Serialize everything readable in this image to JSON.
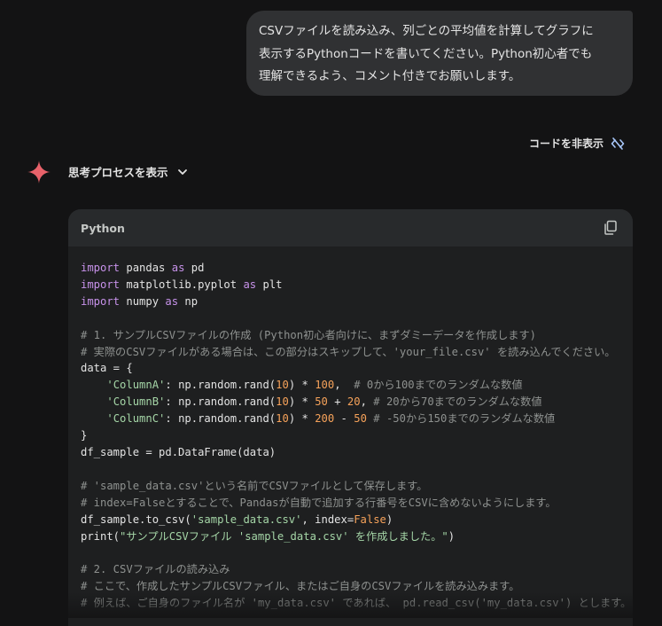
{
  "user_message": {
    "lines": [
      "CSVファイルを読み込み、列ごとの平均値を計算してグラフに",
      "表示するPythonコードを書いてください。Python初心者でも",
      "理解できるよう、コメント付きでお願いします。"
    ]
  },
  "toolbar": {
    "hide_code_label": "コードを非表示",
    "hide_code_icon": "code-off-icon"
  },
  "response": {
    "thinking_label": "思考プロセスを表示",
    "assistant_icon": "sparkle-icon",
    "accent": "#e8626a"
  },
  "code_block": {
    "language": "Python",
    "copy_icon": "copy-icon",
    "lines": [
      [
        [
          "kw",
          "import"
        ],
        [
          "t",
          " pandas "
        ],
        [
          "kw",
          "as"
        ],
        [
          "t",
          " pd"
        ]
      ],
      [
        [
          "kw",
          "import"
        ],
        [
          "t",
          " matplotlib.pyplot "
        ],
        [
          "kw",
          "as"
        ],
        [
          "t",
          " plt"
        ]
      ],
      [
        [
          "kw",
          "import"
        ],
        [
          "t",
          " numpy "
        ],
        [
          "kw",
          "as"
        ],
        [
          "t",
          " np"
        ]
      ],
      [],
      [
        [
          "cm",
          "# 1. サンプルCSVファイルの作成 (Python初心者向けに、まずダミーデータを作成します)"
        ]
      ],
      [
        [
          "cm",
          "# 実際のCSVファイルがある場合は、この部分はスキップして、'your_file.csv' を読み込んでください。"
        ]
      ],
      [
        [
          "t",
          "data = {"
        ]
      ],
      [
        [
          "t",
          "    "
        ],
        [
          "str",
          "'ColumnA'"
        ],
        [
          "t",
          ": np.random.rand("
        ],
        [
          "num",
          "10"
        ],
        [
          "t",
          ") * "
        ],
        [
          "num",
          "100"
        ],
        [
          "t",
          ",  "
        ],
        [
          "cm",
          "# 0から100までのランダムな数値"
        ]
      ],
      [
        [
          "t",
          "    "
        ],
        [
          "str",
          "'ColumnB'"
        ],
        [
          "t",
          ": np.random.rand("
        ],
        [
          "num",
          "10"
        ],
        [
          "t",
          ") * "
        ],
        [
          "num",
          "50"
        ],
        [
          "t",
          " + "
        ],
        [
          "num",
          "20"
        ],
        [
          "t",
          ", "
        ],
        [
          "cm",
          "# 20から70までのランダムな数値"
        ]
      ],
      [
        [
          "t",
          "    "
        ],
        [
          "str",
          "'ColumnC'"
        ],
        [
          "t",
          ": np.random.rand("
        ],
        [
          "num",
          "10"
        ],
        [
          "t",
          ") * "
        ],
        [
          "num",
          "200"
        ],
        [
          "t",
          " - "
        ],
        [
          "num",
          "50"
        ],
        [
          "t",
          " "
        ],
        [
          "cm",
          "# -50から150までのランダムな数値"
        ]
      ],
      [
        [
          "t",
          "}"
        ]
      ],
      [
        [
          "t",
          "df_sample = pd.DataFrame(data)"
        ]
      ],
      [],
      [
        [
          "cm",
          "# 'sample_data.csv'という名前でCSVファイルとして保存します。"
        ]
      ],
      [
        [
          "cm",
          "# index=Falseとすることで、Pandasが自動で追加する行番号をCSVに含めないようにします。"
        ]
      ],
      [
        [
          "t",
          "df_sample.to_csv("
        ],
        [
          "str",
          "'sample_data.csv'"
        ],
        [
          "t",
          ", index="
        ],
        [
          "num",
          "False"
        ],
        [
          "t",
          ")"
        ]
      ],
      [
        [
          "t",
          "print("
        ],
        [
          "str",
          "\"サンプルCSVファイル 'sample_data.csv' を作成しました。\""
        ],
        [
          "t",
          ")"
        ]
      ],
      [],
      [
        [
          "cm",
          "# 2. CSVファイルの読み込み"
        ]
      ],
      [
        [
          "cm",
          "# ここで、作成したサンプルCSVファイル、またはご自身のCSVファイルを読み込みます。"
        ]
      ],
      [
        [
          "cm",
          "# 例えば、ご自身のファイル名が 'my_data.csv' であれば、 pd.read_csv('my_data.csv') とします。"
        ]
      ]
    ]
  }
}
